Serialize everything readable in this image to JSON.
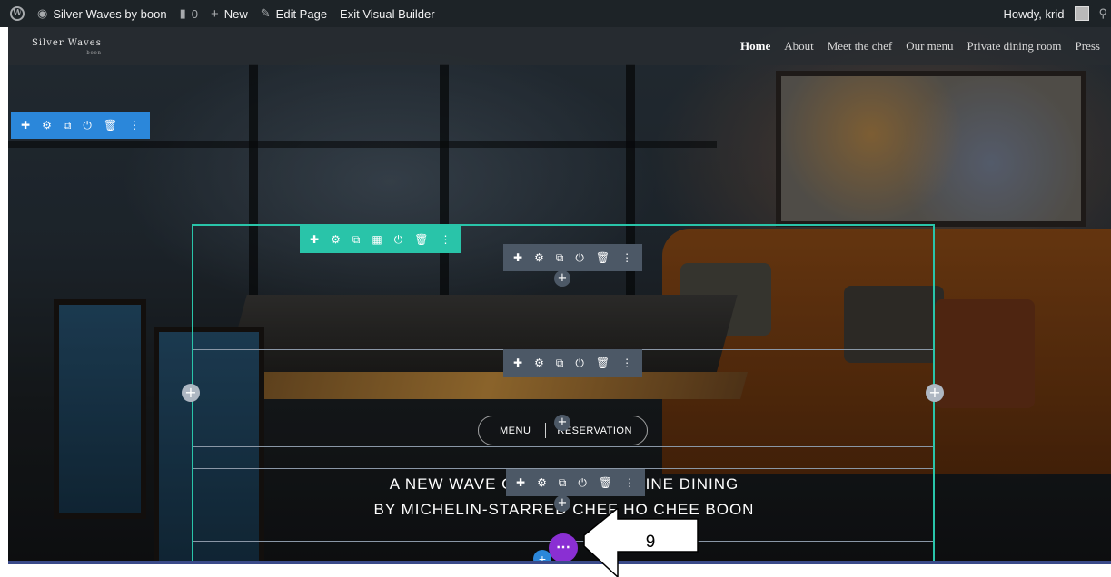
{
  "admin_bar": {
    "site_name": "Silver Waves by boon",
    "comments_count": "0",
    "new_label": "New",
    "edit_page_label": "Edit Page",
    "exit_builder_label": "Exit Visual Builder",
    "howdy": "Howdy, krid"
  },
  "site": {
    "logo_text": "Silver Waves",
    "logo_sub": "boon"
  },
  "nav": {
    "items": [
      "Home",
      "About",
      "Meet the chef",
      "Our menu",
      "Private dining room",
      "Press"
    ],
    "active": "Home"
  },
  "cta": {
    "menu_label": "MENU",
    "reservation_label": "RESERVATION"
  },
  "tagline": {
    "line1": "A NEW WAVE OF SINGAPORE FINE DINING",
    "line2": "BY MICHELIN-STARRED CHEF HO CHEE BOON"
  },
  "annotation": {
    "step_number": "9"
  },
  "colors": {
    "section_toolbar": "#2b87da",
    "row_toolbar": "#29c4a9",
    "module_toolbar": "#4c5866",
    "more_button": "#8a2fd3",
    "admin_bar": "#1d2327"
  }
}
